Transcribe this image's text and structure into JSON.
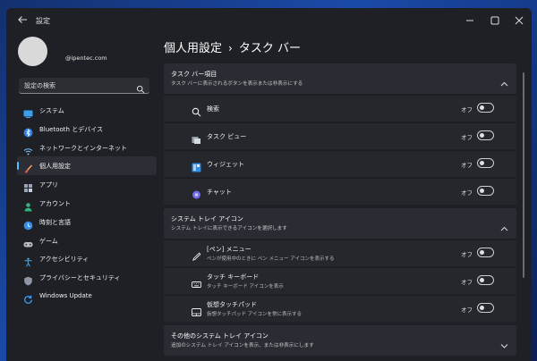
{
  "window": {
    "title": "設定"
  },
  "account": {
    "email": "@ipentec.com"
  },
  "search": {
    "placeholder": "設定の検索"
  },
  "sidebar": {
    "items": [
      {
        "label": "システム",
        "icon": "monitor-icon",
        "active": false
      },
      {
        "label": "Bluetooth とデバイス",
        "icon": "bluetooth-icon",
        "active": false
      },
      {
        "label": "ネットワークとインターネット",
        "icon": "wifi-icon",
        "active": false
      },
      {
        "label": "個人用設定",
        "icon": "brush-icon",
        "active": true
      },
      {
        "label": "アプリ",
        "icon": "apps-icon",
        "active": false
      },
      {
        "label": "アカウント",
        "icon": "person-icon",
        "active": false
      },
      {
        "label": "時刻と言語",
        "icon": "globe-clock-icon",
        "active": false
      },
      {
        "label": "ゲーム",
        "icon": "gamepad-icon",
        "active": false
      },
      {
        "label": "アクセシビリティ",
        "icon": "accessibility-icon",
        "active": false
      },
      {
        "label": "プライバシーとセキュリティ",
        "icon": "shield-icon",
        "active": false
      },
      {
        "label": "Windows Update",
        "icon": "update-icon",
        "active": false
      }
    ]
  },
  "breadcrumb": {
    "parent": "個人用設定",
    "separator": "›",
    "current": "タスク バー"
  },
  "sections": {
    "taskbar_items": {
      "title": "タスク バー項目",
      "subtitle": "タスク バーに表示されるボタンを表示または非表示にする",
      "rows": [
        {
          "label": "検索",
          "state": "オフ",
          "icon": "search-icon"
        },
        {
          "label": "タスク ビュー",
          "state": "オフ",
          "icon": "task-view-icon"
        },
        {
          "label": "ウィジェット",
          "state": "オフ",
          "icon": "widgets-icon"
        },
        {
          "label": "チャット",
          "state": "オフ",
          "icon": "chat-icon"
        }
      ]
    },
    "tray_icons": {
      "title": "システム トレイ アイコン",
      "subtitle": "システム トレイに表示できるアイコンを選択します",
      "rows": [
        {
          "label": "[ペン] メニュー",
          "sub": "ペンが使用中のときに ペン メニュー アイコンを表示する",
          "state": "オフ",
          "icon": "pen-icon"
        },
        {
          "label": "タッチ キーボード",
          "sub": "タッチ キーボード アイコンを表示",
          "state": "オフ",
          "icon": "keyboard-icon"
        },
        {
          "label": "仮想タッチパッド",
          "sub": "仮想タッチパッド アイコンを常に表示する",
          "state": "オフ",
          "icon": "touchpad-icon"
        }
      ]
    },
    "other_tray": {
      "title": "その他のシステム トレイ アイコン",
      "subtitle": "追加のシステム トレイ アイコンを表示、または非表示にします"
    }
  },
  "colors": {
    "accent": "#4cc2ff",
    "window_bg": "#1f2026",
    "card_bg": "#2b2c33"
  }
}
